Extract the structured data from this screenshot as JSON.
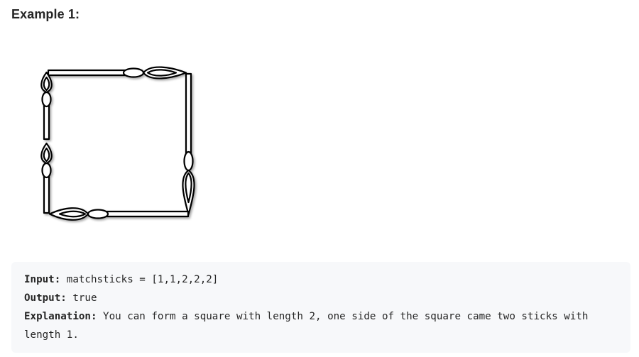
{
  "heading": "Example 1:",
  "example": {
    "input_label": "Input:",
    "input_value": " matchsticks = [1,1,2,2,2]",
    "output_label": "Output:",
    "output_value": " true",
    "explanation_label": "Explanation:",
    "explanation_value": " You can form a square with length 2, one side of the square came two sticks with length 1."
  },
  "illustration": {
    "icon": "matchstick-square-icon",
    "stroke_color": "#000000",
    "fill_color": "#ffffff"
  }
}
